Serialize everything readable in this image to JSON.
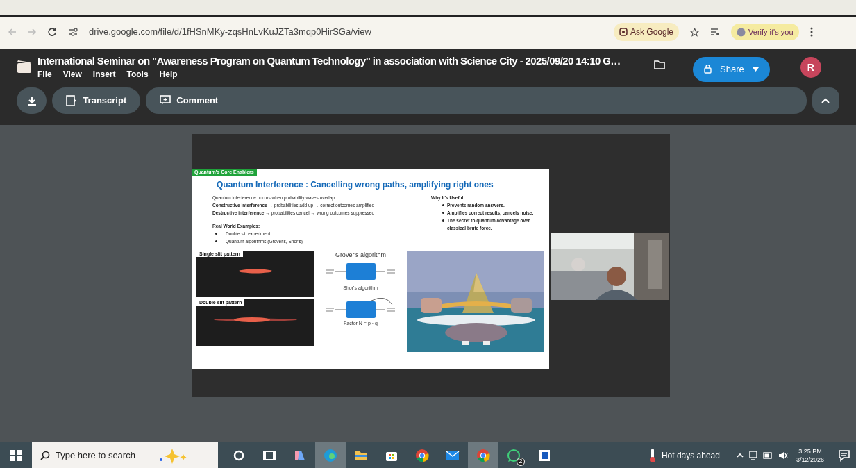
{
  "browser": {
    "url": "drive.google.com/file/d/1fHSnMKy-zqsHnLvKuJZTa3mqp0HirSGa/view",
    "ask_google": "Ask Google",
    "profile": "Verify it's you"
  },
  "viewer": {
    "title": "International Seminar on \"Awareness Program on Quantum Technology\" in association with Science City - 2025/09/20 14:10 G…",
    "menu": [
      "File",
      "View",
      "Insert",
      "Tools",
      "Help"
    ],
    "share": "Share",
    "avatar": "R",
    "toolbar": [
      "Transcript",
      "Comment"
    ]
  },
  "slide": {
    "tag": "Quantum's Core Enablers",
    "heading": "Quantum Interference : Cancelling wrong paths, amplifying right ones",
    "lines": [
      "Quantum interference occurs when probability waves overlap",
      "**Constructive interference** → probabilities add up → correct outcomes amplified",
      "**Destructive interference** → probabilities cancel → wrong outcomes suppressed"
    ],
    "examples_title": "Real World Examples:",
    "examples": [
      "Double slit experiment",
      "Quantum algorithms (Grover's, Shor's)"
    ],
    "useful_title": "Why It's Useful:",
    "useful": [
      "Prevents random answers.",
      "Amplifies correct results, cancels noise.",
      "The secret to quantum advantage over classical brute force."
    ],
    "panels": [
      "Single slit pattern",
      "Double slit pattern"
    ],
    "grover": "Grover's algorithm",
    "shor": "Shor's algorithm",
    "factor": "Factor N = p · q"
  },
  "taskbar": {
    "search_placeholder": "Type here to search",
    "apps": [
      {
        "kind": "circle",
        "active": false
      },
      {
        "kind": "taskview",
        "active": false
      },
      {
        "kind": "copilot",
        "active": false
      },
      {
        "kind": "edge",
        "active": true
      },
      {
        "kind": "folder",
        "active": false
      },
      {
        "kind": "store",
        "active": false
      },
      {
        "kind": "chrome",
        "active": false
      },
      {
        "kind": "mail",
        "active": false
      },
      {
        "kind": "chrome",
        "active": true
      },
      {
        "kind": "whatsapp",
        "active": false,
        "badge": "2"
      },
      {
        "kind": "word",
        "active": false
      }
    ],
    "weather": "Hot days ahead",
    "time": "3:25 PM",
    "date": "3/12/2026"
  }
}
